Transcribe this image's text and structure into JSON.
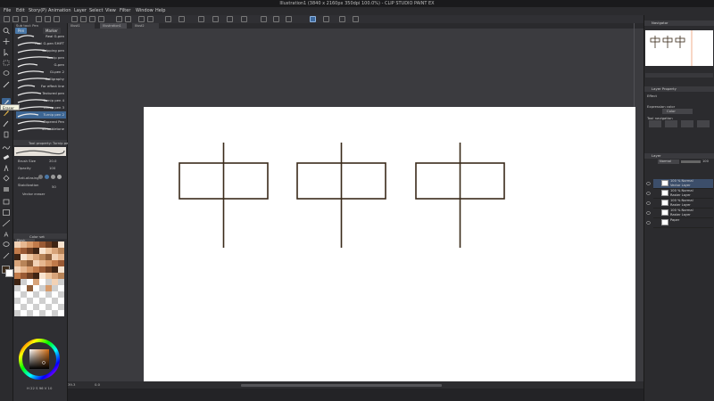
{
  "title": "Illustration1 (3840 x 2160px 350dpi 100.0%) - CLIP STUDIO PAINT EX",
  "menu": [
    "File",
    "Edit",
    "Story(P)",
    "Animation",
    "Layer",
    "Select",
    "View",
    "Filter",
    "Window",
    "Help"
  ],
  "subtool": {
    "header": "Sub tool: Pen",
    "tabs": [
      "Pen",
      "Marker"
    ],
    "brushes": [
      "Real G-pen",
      "Real G-pen SHIFT",
      "Dripping pen",
      "Turnip pen",
      "G-pen",
      "Gi-pen 2",
      "Calligraphy",
      "For effect line",
      "Textured pen",
      "Turnip pen 4",
      "Turnip pen 3",
      "Turnip pen 2",
      "Tapered Pen",
      "Scrimbletone"
    ],
    "selected_index": 11,
    "tooltip": "Eraser"
  },
  "tool_property": {
    "header": "Tool property: Turnip pen 2",
    "brush_size_label": "Brush Size",
    "brush_size_value": "20.0",
    "opacity_label": "Opacity",
    "opacity_value": "100",
    "antialias_label": "Anti-aliasing",
    "stabilization_label": "Stabilization",
    "stabilization_value": "50",
    "vector_label": "Vector eraser"
  },
  "color_set": {
    "header": "Color set",
    "name": "Flesh"
  },
  "color_wheel": {
    "value": "H 22 S 96 V 10"
  },
  "status": {
    "zoom": "39.3",
    "angle": "0.0"
  },
  "navigator": {
    "header": "Navigator"
  },
  "layer_property": {
    "header": "Layer Property",
    "effect_label": "Effect",
    "expression_color_label": "Expression color",
    "expression_color_value": "Color",
    "tool_navigation_label": "Tool navigation"
  },
  "layer_panel": {
    "header": "Layer",
    "blend_mode": "Normal",
    "opacity": "100",
    "layers": [
      {
        "line1": "100 % Normal",
        "line2": "Vector Layer",
        "selected": true
      },
      {
        "line1": "100 % Normal",
        "line2": "Raster Layer",
        "selected": false
      },
      {
        "line1": "100 % Normal",
        "line2": "Raster Layer",
        "selected": false
      },
      {
        "line1": "100 % Normal",
        "line2": "Raster Layer",
        "selected": false
      },
      {
        "line1": "Paper",
        "line2": "",
        "selected": false
      }
    ]
  },
  "doc_tabs": [
    "Illust1",
    "Illustration1",
    "Illust2"
  ],
  "colors": {
    "accent": "#3d6694",
    "stroke": "#3a2a1a"
  }
}
